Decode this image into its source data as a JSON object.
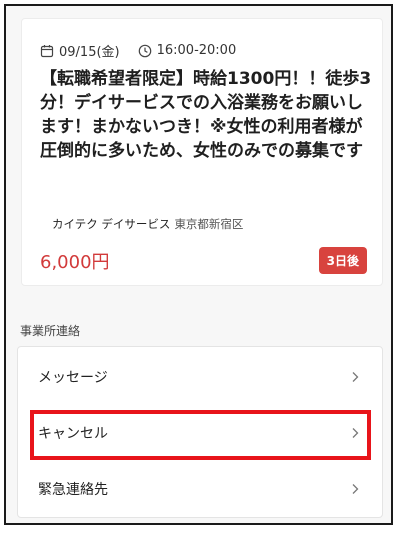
{
  "job": {
    "date": "09/15(金)",
    "time": "16:00-20:00",
    "title": "【転職希望者限定】時給1300円！！徒歩3分！デイサービスでの入浴業務をお願いします！まかないつき！※女性の利用者様が圧倒的に多いため、女性のみでの募集です",
    "company": "カイテク デイサービス",
    "location": "東京都新宿区",
    "price": "6,000円",
    "badge": "3日後"
  },
  "contact": {
    "section_label": "事業所連絡",
    "items": [
      {
        "label": "メッセージ"
      },
      {
        "label": "キャンセル"
      },
      {
        "label": "緊急連絡先"
      }
    ]
  },
  "colors": {
    "price": "#d23a3a",
    "badge": "#d8433e",
    "highlight": "#e8141a"
  },
  "icons": {
    "date": "calendar-icon",
    "time": "clock-icon",
    "row": "chevron-right-icon"
  }
}
